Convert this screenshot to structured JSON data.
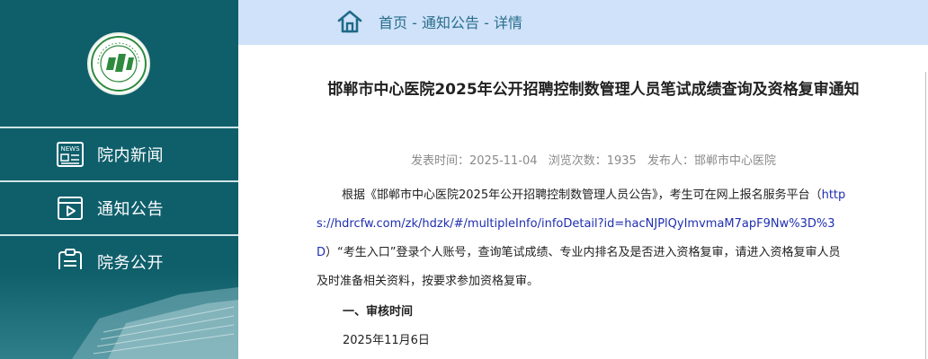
{
  "sidebar": {
    "logo_alt_text": "邯郸市中心医院",
    "items": [
      {
        "label": "院内新闻",
        "icon": "news-icon"
      },
      {
        "label": "通知公告",
        "icon": "video-icon"
      },
      {
        "label": "院务公开",
        "icon": "clipboard-icon"
      }
    ]
  },
  "breadcrumb": {
    "home": "首页",
    "sep": " - ",
    "section": "通知公告",
    "current": "详情"
  },
  "article": {
    "title": "邯郸市中心医院2025年公开招聘控制数管理人员笔试成绩查询及资格复审通知",
    "publish_label": "发表时间：",
    "publish_time": "2025-11-04",
    "views_label": "浏览次数：",
    "views": "1935",
    "publisher_label": "发布人：",
    "publisher": "邯郸市中心医院",
    "para_before": "根据《邯郸市中心医院2025年公开招聘控制数管理人员公告》，考生可在网上报名服务平台（",
    "link": "https://hdrcfw.com/zk/hdzk/#/multipleInfo/infoDetail?id=hacNJPlQyImvmaM7apF9Nw%3D%3D",
    "para_after": "）“考生入口”登录个人账号，查询笔试成绩、专业内排名及是否进入资格复审，请进入资格复审人员及时准备相关资料，按要求参加资格复审。",
    "section1_heading": "一、审核时间",
    "section1_date": "2025年11月6日"
  },
  "colors": {
    "sidebar": "#0f5f6b",
    "topbar": "#cfe2f9",
    "link": "#1f2fb0"
  }
}
